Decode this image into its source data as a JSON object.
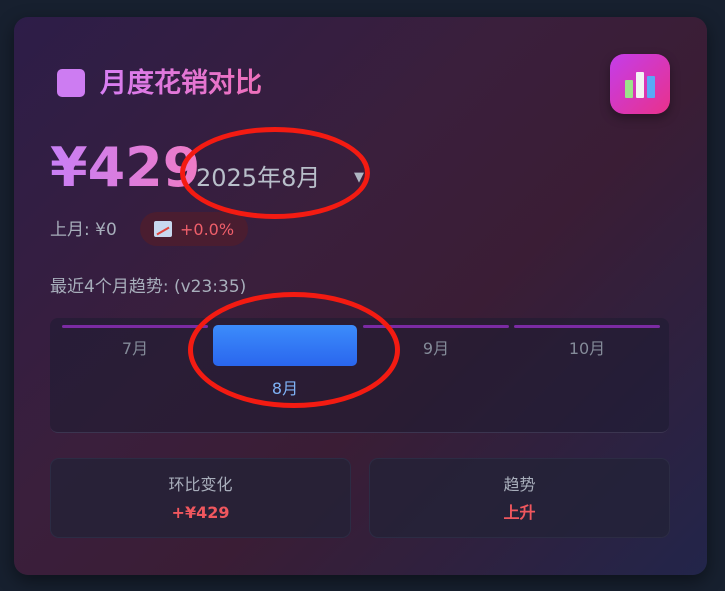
{
  "header": {
    "title": "月度花销对比",
    "icon": "chart-icon",
    "accent": "#cd7cf2"
  },
  "summary": {
    "amount": "¥429",
    "month_selected": "2025年8月",
    "previous": "上月: ¥0",
    "change": "+0.0%",
    "change_icon": "trend-up-icon"
  },
  "trend": {
    "label": "最近4个月趋势: (v23:35)",
    "months": [
      {
        "label": "7月",
        "active": false
      },
      {
        "label": "8月",
        "active": true
      },
      {
        "label": "9月",
        "active": false
      },
      {
        "label": "10月",
        "active": false
      }
    ]
  },
  "stats": [
    {
      "key": "环比变化",
      "value": "+¥429"
    },
    {
      "key": "趋势",
      "value": "上升"
    }
  ],
  "colors": {
    "active_bar": "#3c8cfb",
    "negative": "#f0575e",
    "annotation": "#f31b12"
  }
}
